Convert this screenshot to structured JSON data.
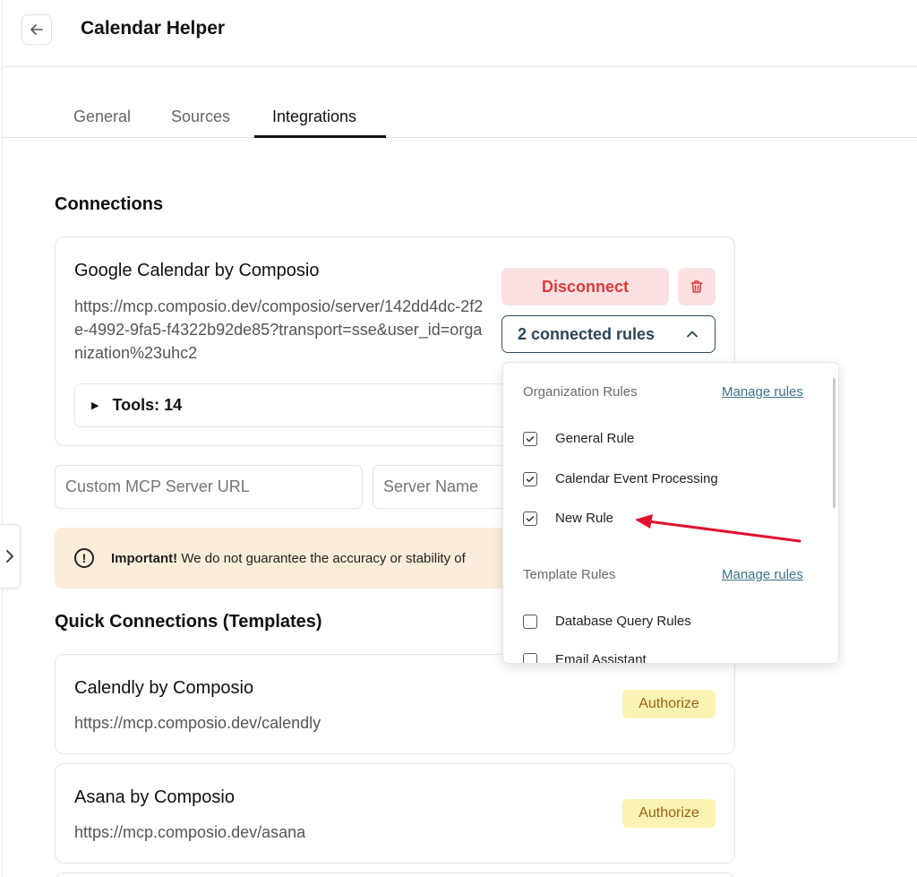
{
  "header": {
    "title": "Calendar Helper"
  },
  "tabs": [
    {
      "label": "General"
    },
    {
      "label": "Sources"
    },
    {
      "label": "Integrations",
      "active": true
    }
  ],
  "connections": {
    "title": "Connections",
    "card": {
      "name": "Google Calendar by Composio",
      "url": "https://mcp.composio.dev/composio/server/142dd4dc-2f2e-4992-9fa5-f4322b92de85?transport=sse&user_id=organization%23uhc2",
      "disconnect_label": "Disconnect",
      "rules_label": "2 connected rules",
      "tools_label": "Tools: 14"
    },
    "custom_url_placeholder": "Custom MCP Server URL",
    "server_name_placeholder": "Server Name"
  },
  "notice": {
    "strong": "Important!",
    "text": " We do not guarantee the accuracy or stability of"
  },
  "rules_dropdown": {
    "org_title": "Organization Rules",
    "template_title": "Template Rules",
    "manage_label": "Manage rules",
    "org_rules": [
      {
        "label": "General Rule",
        "checked": true
      },
      {
        "label": "Calendar Event Processing",
        "checked": true
      },
      {
        "label": "New Rule",
        "checked": true
      }
    ],
    "template_rules": [
      {
        "label": "Database Query Rules",
        "checked": false
      },
      {
        "label": "Email Assistant",
        "checked": false
      }
    ]
  },
  "quick": {
    "title": "Quick Connections (Templates)",
    "authorize_label": "Authorize",
    "items": [
      {
        "name": "Calendly by Composio",
        "url": "https://mcp.composio.dev/calendly"
      },
      {
        "name": "Asana by Composio",
        "url": "https://mcp.composio.dev/asana"
      }
    ]
  },
  "colors": {
    "disconnect_bg": "#fbe1e1",
    "disconnect_text": "#dc3b3b",
    "authorize_bg": "#fbf3b4",
    "authorize_text": "#9a6010",
    "notice_bg": "#fbedd9",
    "annotation_arrow": "#e0112b"
  }
}
